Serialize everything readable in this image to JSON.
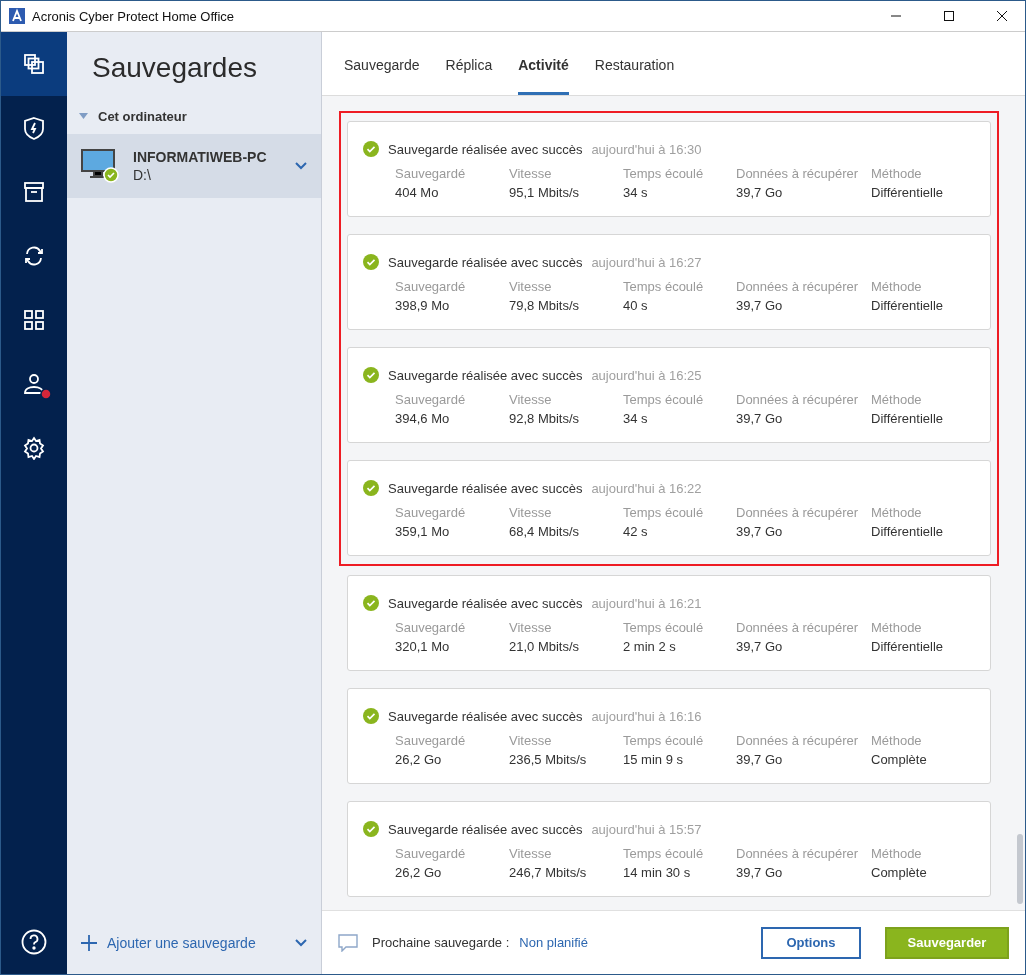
{
  "window": {
    "title": "Acronis Cyber Protect Home Office"
  },
  "nav": [
    {
      "kind": "backup",
      "selected": true
    },
    {
      "kind": "protection",
      "selected": false
    },
    {
      "kind": "archive",
      "selected": false
    },
    {
      "kind": "sync",
      "selected": false
    },
    {
      "kind": "tools",
      "selected": false
    },
    {
      "kind": "account",
      "selected": false,
      "alert": true
    },
    {
      "kind": "settings",
      "selected": false
    }
  ],
  "sidebar": {
    "title": "Sauvegardes",
    "group": {
      "label": "Cet ordinateur",
      "expanded": true
    },
    "items": [
      {
        "name": "INFORMATIWEB-PC",
        "path": "D:\\",
        "selected": true
      }
    ],
    "add_label": "Ajouter une sauvegarde"
  },
  "tabs": [
    {
      "label": "Sauvegarde",
      "selected": false
    },
    {
      "label": "Réplica",
      "selected": false
    },
    {
      "label": "Activité",
      "selected": true
    },
    {
      "label": "Restauration",
      "selected": false
    }
  ],
  "activity": [
    {
      "status": "Sauvegarde réalisée avec succès",
      "time": "aujourd'hui à 16:30",
      "highlighted": true,
      "fields": [
        {
          "label": "Sauvegardé",
          "value": "404 Mo"
        },
        {
          "label": "Vitesse",
          "value": "95,1 Mbits/s"
        },
        {
          "label": "Temps écoulé",
          "value": "34 s"
        },
        {
          "label": "Données à récupérer",
          "value": "39,7 Go"
        },
        {
          "label": "Méthode",
          "value": "Différentielle"
        }
      ]
    },
    {
      "status": "Sauvegarde réalisée avec succès",
      "time": "aujourd'hui à 16:27",
      "highlighted": true,
      "fields": [
        {
          "label": "Sauvegardé",
          "value": "398,9 Mo"
        },
        {
          "label": "Vitesse",
          "value": "79,8 Mbits/s"
        },
        {
          "label": "Temps écoulé",
          "value": "40 s"
        },
        {
          "label": "Données à récupérer",
          "value": "39,7 Go"
        },
        {
          "label": "Méthode",
          "value": "Différentielle"
        }
      ]
    },
    {
      "status": "Sauvegarde réalisée avec succès",
      "time": "aujourd'hui à 16:25",
      "highlighted": true,
      "fields": [
        {
          "label": "Sauvegardé",
          "value": "394,6 Mo"
        },
        {
          "label": "Vitesse",
          "value": "92,8 Mbits/s"
        },
        {
          "label": "Temps écoulé",
          "value": "34 s"
        },
        {
          "label": "Données à récupérer",
          "value": "39,7 Go"
        },
        {
          "label": "Méthode",
          "value": "Différentielle"
        }
      ]
    },
    {
      "status": "Sauvegarde réalisée avec succès",
      "time": "aujourd'hui à 16:22",
      "highlighted": true,
      "fields": [
        {
          "label": "Sauvegardé",
          "value": "359,1 Mo"
        },
        {
          "label": "Vitesse",
          "value": "68,4 Mbits/s"
        },
        {
          "label": "Temps écoulé",
          "value": "42 s"
        },
        {
          "label": "Données à récupérer",
          "value": "39,7 Go"
        },
        {
          "label": "Méthode",
          "value": "Différentielle"
        }
      ]
    },
    {
      "status": "Sauvegarde réalisée avec succès",
      "time": "aujourd'hui à 16:21",
      "highlighted": false,
      "fields": [
        {
          "label": "Sauvegardé",
          "value": "320,1 Mo"
        },
        {
          "label": "Vitesse",
          "value": "21,0 Mbits/s"
        },
        {
          "label": "Temps écoulé",
          "value": "2 min 2 s"
        },
        {
          "label": "Données à récupérer",
          "value": "39,7 Go"
        },
        {
          "label": "Méthode",
          "value": "Différentielle"
        }
      ]
    },
    {
      "status": "Sauvegarde réalisée avec succès",
      "time": "aujourd'hui à 16:16",
      "highlighted": false,
      "fields": [
        {
          "label": "Sauvegardé",
          "value": "26,2 Go"
        },
        {
          "label": "Vitesse",
          "value": "236,5 Mbits/s"
        },
        {
          "label": "Temps écoulé",
          "value": "15 min 9 s"
        },
        {
          "label": "Données à récupérer",
          "value": "39,7 Go"
        },
        {
          "label": "Méthode",
          "value": "Complète"
        }
      ]
    },
    {
      "status": "Sauvegarde réalisée avec succès",
      "time": "aujourd'hui à 15:57",
      "highlighted": false,
      "fields": [
        {
          "label": "Sauvegardé",
          "value": "26,2 Go"
        },
        {
          "label": "Vitesse",
          "value": "246,7 Mbits/s"
        },
        {
          "label": "Temps écoulé",
          "value": "14 min 30 s"
        },
        {
          "label": "Données à récupérer",
          "value": "39,7 Go"
        },
        {
          "label": "Méthode",
          "value": "Complète"
        }
      ]
    }
  ],
  "footer": {
    "next_label": "Prochaine sauvegarde :",
    "next_value": "Non planifié",
    "buttons": [
      {
        "label": "Options",
        "kind": "secondary"
      },
      {
        "label": "Sauvegarder",
        "kind": "primary"
      }
    ]
  }
}
